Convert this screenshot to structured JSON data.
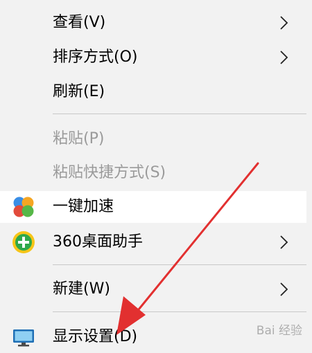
{
  "menu": {
    "view": "查看(V)",
    "sort": "排序方式(O)",
    "refresh": "刷新(E)",
    "paste": "粘贴(P)",
    "paste_shortcut": "粘贴快捷方式(S)",
    "accelerate": "一键加速",
    "desktop_helper": "360桌面助手",
    "new": "新建(W)",
    "display_settings": "显示设置(D)"
  },
  "watermark": "Bai 经验",
  "colors": {
    "menu_background": "#f2f2f2",
    "highlight_background": "#ffffff",
    "disabled_text": "#9a9a9a",
    "separator": "#c8c8c8",
    "arrow": "#e23030"
  }
}
